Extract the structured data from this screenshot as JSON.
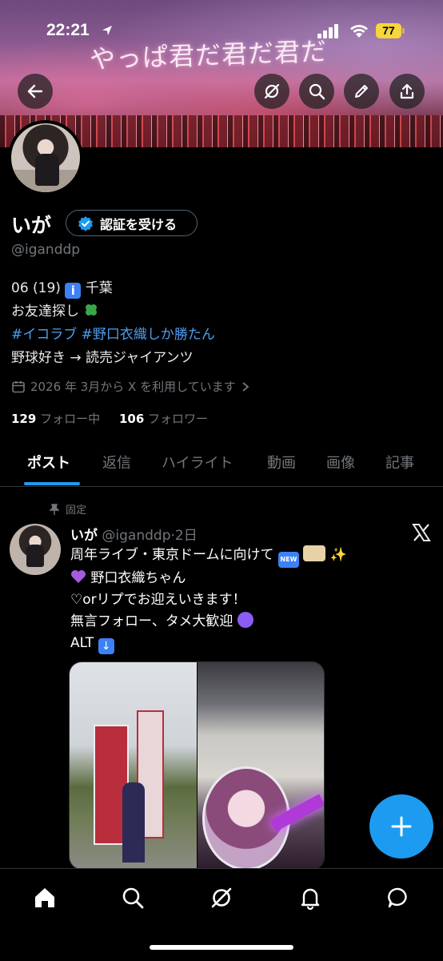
{
  "status_bar": {
    "time": "22:21",
    "battery": "77"
  },
  "banner": {
    "text": "やっぱ君だ君だ君だ"
  },
  "profile": {
    "name": "いが",
    "verify_label": "認証を受ける",
    "handle": "@iganddp",
    "bio_line1": "06 (19) ",
    "bio_line1_place": " 千葉",
    "bio_line2": "お友達探し",
    "bio_tag1": "#イコラブ",
    "bio_tag2": "#野口衣織しか勝たん",
    "bio_line4": "野球好き → 読売ジャイアンツ",
    "joined": "2026 年 3月から X を利用しています",
    "following_count": "129",
    "following_label": "フォロー中",
    "followers_count": "106",
    "followers_label": "フォロワー"
  },
  "tabs": [
    "ポスト",
    "返信",
    "ハイライト",
    "動画",
    "画像",
    "記事"
  ],
  "post": {
    "pinned_label": "固定",
    "author": "いが",
    "handle": "@iganddp",
    "age": "·2日",
    "line1": "周年ライブ・東京ドームに向けて",
    "line2": "野口衣織ちゃん",
    "line3": "♡orリプでお迎えいきます！",
    "line4": "無言フォロー、タメ大歓迎",
    "line5": "ALT"
  },
  "icons": {
    "back": "back-arrow-icon",
    "grok": "grok-icon",
    "search": "search-icon",
    "edit": "pencil-icon",
    "share": "share-icon",
    "compose": "plus-icon",
    "nav": [
      "home-icon",
      "search-icon",
      "grok-icon",
      "bell-icon",
      "chat-icon"
    ]
  },
  "colors": {
    "accent": "#1d9bf0",
    "link": "#4f9ef0",
    "muted": "#71767b",
    "background": "#000000"
  }
}
